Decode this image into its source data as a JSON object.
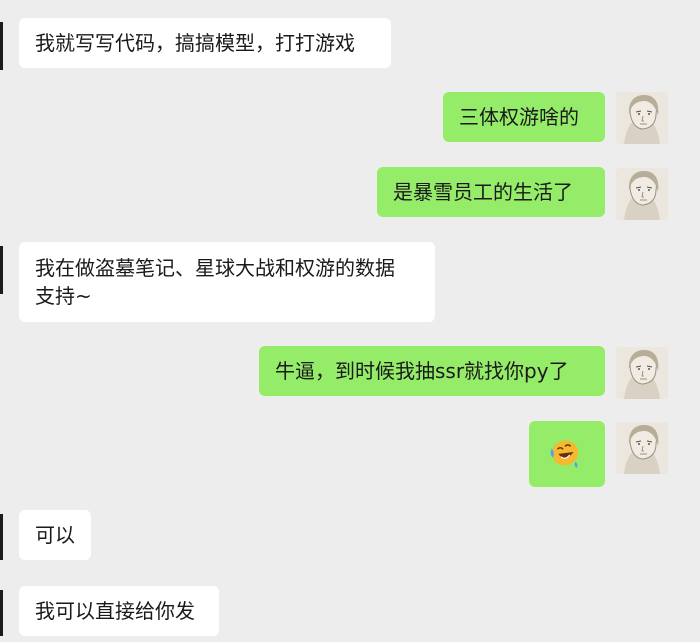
{
  "messages": [
    {
      "side": "left",
      "text": "我就写写代码，搞搞模型，打打游戏"
    },
    {
      "side": "right",
      "text": "三体权游啥的"
    },
    {
      "side": "right",
      "text": "是暴雪员工的生活了"
    },
    {
      "side": "left",
      "line1": "我在做盗墓笔记、星球大战和权游的数据",
      "line2": "支持~"
    },
    {
      "side": "right",
      "text": "牛逼，到时候我抽ssr就找你py了"
    },
    {
      "side": "right",
      "emoji": "laughing-tears-emoji"
    },
    {
      "side": "left",
      "text": "可以"
    },
    {
      "side": "left",
      "text": "我可以直接给你发"
    }
  ],
  "colors": {
    "background": "#ededed",
    "left_bubble": "#ffffff",
    "right_bubble": "#95ec69",
    "text": "#1a1a1a"
  }
}
